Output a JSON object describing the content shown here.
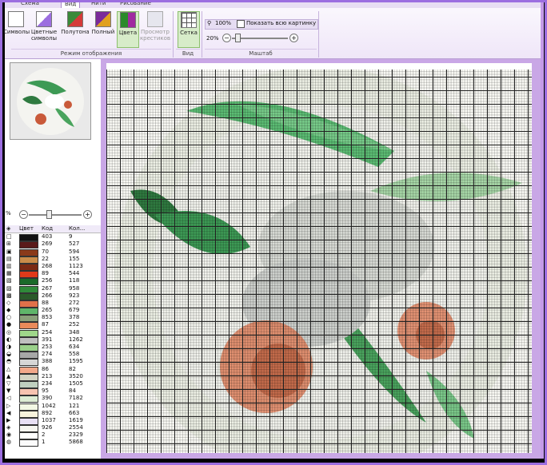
{
  "ribbon": {
    "tabs": [
      "Схема",
      "Вид",
      "Нити",
      "Рисование"
    ],
    "active_tab": "Вид",
    "buttons": {
      "symbols": "Символы",
      "color_symbols": "Цветные символы",
      "half": "Полутона",
      "full": "Полный",
      "colors": "Цвета",
      "cross_view": "Просмотр крестиков",
      "grid": "Сетка"
    },
    "groups": {
      "display_mode": "Режим отображения",
      "view": "Вид",
      "scale": "Маштаб"
    },
    "zoom": {
      "percent_label": "100%",
      "show_whole": "Показать всю картинку",
      "slider_value": "20%"
    }
  },
  "left": {
    "zoom_value": "%",
    "palette_headers": [
      "Цвет",
      "Код",
      "Кол..."
    ],
    "palette": [
      {
        "sym": "□",
        "color": "#111111",
        "code": "403",
        "count": "9"
      },
      {
        "sym": "⊞",
        "color": "#5a1a1a",
        "code": "269",
        "count": "527"
      },
      {
        "sym": "▣",
        "color": "#8a3a1a",
        "code": "70",
        "count": "594"
      },
      {
        "sym": "▤",
        "color": "#c98c4a",
        "code": "22",
        "count": "155"
      },
      {
        "sym": "▥",
        "color": "#7a2a14",
        "code": "268",
        "count": "1123"
      },
      {
        "sym": "▦",
        "color": "#e03a1a",
        "code": "89",
        "count": "544"
      },
      {
        "sym": "▧",
        "color": "#1a6a2a",
        "code": "256",
        "count": "118"
      },
      {
        "sym": "▨",
        "color": "#2f8a3a",
        "code": "267",
        "count": "958"
      },
      {
        "sym": "▩",
        "color": "#2a5a2a",
        "code": "266",
        "count": "923"
      },
      {
        "sym": "◇",
        "color": "#e0704a",
        "code": "88",
        "count": "272"
      },
      {
        "sym": "◆",
        "color": "#5fb56a",
        "code": "265",
        "count": "679"
      },
      {
        "sym": "○",
        "color": "#8aa07a",
        "code": "853",
        "count": "378"
      },
      {
        "sym": "●",
        "color": "#ea8a5a",
        "code": "87",
        "count": "252"
      },
      {
        "sym": "◎",
        "color": "#9fd78a",
        "code": "254",
        "count": "348"
      },
      {
        "sym": "◐",
        "color": "#bfbfbf",
        "code": "391",
        "count": "1262"
      },
      {
        "sym": "◑",
        "color": "#9ad08a",
        "code": "253",
        "count": "634"
      },
      {
        "sym": "◒",
        "color": "#a7a7a7",
        "code": "274",
        "count": "558"
      },
      {
        "sym": "◓",
        "color": "#d6d6d6",
        "code": "388",
        "count": "1595"
      },
      {
        "sym": "△",
        "color": "#f2a88a",
        "code": "86",
        "count": "82"
      },
      {
        "sym": "▲",
        "color": "#d3d3c3",
        "code": "213",
        "count": "3520"
      },
      {
        "sym": "▽",
        "color": "#bfcfbf",
        "code": "234",
        "count": "1505"
      },
      {
        "sym": "▼",
        "color": "#f7c3b0",
        "code": "95",
        "count": "84"
      },
      {
        "sym": "◁",
        "color": "#ddecd4",
        "code": "390",
        "count": "7182"
      },
      {
        "sym": "▷",
        "color": "#f3f8e4",
        "code": "1042",
        "count": "121"
      },
      {
        "sym": "◀",
        "color": "#f7f2dc",
        "code": "892",
        "count": "663"
      },
      {
        "sym": "▶",
        "color": "#e8e0f4",
        "code": "1037",
        "count": "1619"
      },
      {
        "sym": "◈",
        "color": "#f6f6f0",
        "code": "926",
        "count": "2554"
      },
      {
        "sym": "◉",
        "color": "#ffffff",
        "code": "2",
        "count": "2329"
      },
      {
        "sym": "◍",
        "color": "#fbfbfb",
        "code": "1",
        "count": "5868"
      }
    ]
  },
  "colors": {
    "accent": "#9c6ee0",
    "ribbon_bg": "#efe6f8",
    "selected_btn": "#d7ecc9"
  }
}
